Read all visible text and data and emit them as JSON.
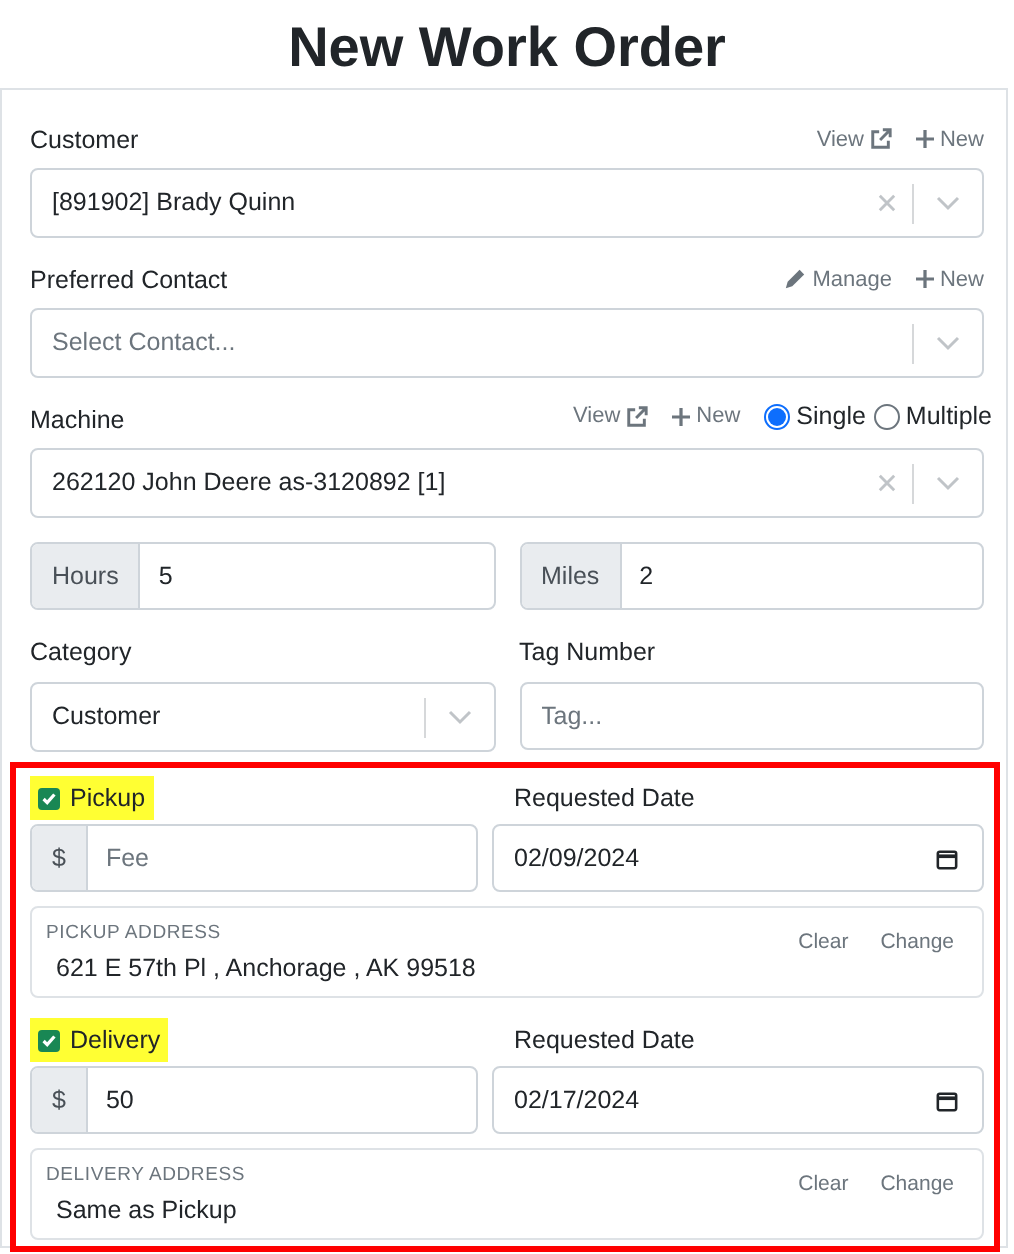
{
  "title": "New Work Order",
  "customer": {
    "label": "Customer",
    "links": [
      {
        "kind": "view",
        "label": "View"
      },
      {
        "kind": "new",
        "label": "New"
      }
    ],
    "value": "[891902] Brady Quinn"
  },
  "preferred_contact": {
    "label": "Preferred Contact",
    "links": [
      {
        "kind": "manage",
        "label": "Manage"
      },
      {
        "kind": "new",
        "label": "New"
      }
    ],
    "placeholder": "Select Contact..."
  },
  "machine": {
    "label": "Machine",
    "links": [
      {
        "kind": "view",
        "label": "View"
      },
      {
        "kind": "new",
        "label": "New"
      }
    ],
    "modes": [
      {
        "label": "Single",
        "selected": true
      },
      {
        "label": "Multiple",
        "selected": false
      }
    ],
    "value": "262120 John Deere as-3120892 [1]"
  },
  "hours": {
    "label": "Hours",
    "value": "5"
  },
  "miles": {
    "label": "Miles",
    "value": "2"
  },
  "category": {
    "label": "Category",
    "value": "Customer"
  },
  "tag_number": {
    "label": "Tag Number",
    "placeholder": "Tag..."
  },
  "transport": [
    {
      "label": "Pickup",
      "checked": true,
      "highlighted": true,
      "date_label": "Requested Date",
      "currency": "$",
      "fee_placeholder": "Fee",
      "date": "02/09/2024",
      "address_label": "PICKUP ADDRESS",
      "address": "621 E 57th Pl , Anchorage , AK 99518",
      "actions": [
        "Clear",
        "Change"
      ]
    },
    {
      "label": "Delivery",
      "checked": true,
      "highlighted": true,
      "date_label": "Requested Date",
      "currency": "$",
      "fee": "50",
      "date": "02/17/2024",
      "address_label": "DELIVERY ADDRESS",
      "address": "Same as Pickup",
      "actions": [
        "Clear",
        "Change"
      ]
    }
  ]
}
